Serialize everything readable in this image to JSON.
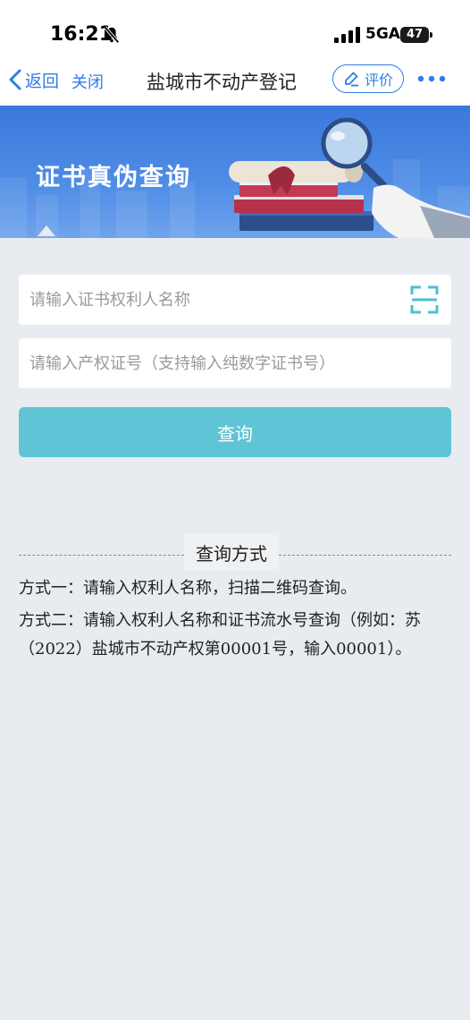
{
  "status_bar": {
    "time": "16:21",
    "network": "5GA",
    "battery": "47"
  },
  "nav": {
    "back_label": "返回",
    "close_label": "关闭",
    "title": "盐城市不动产登记",
    "rate_label": "评价"
  },
  "banner": {
    "title": "证书真伪查询"
  },
  "form": {
    "holder_placeholder": "请输入证书权利人名称",
    "cert_placeholder": "请输入产权证号（支持输入纯数字证书号）",
    "submit_label": "查询"
  },
  "methods": {
    "title": "查询方式",
    "method1": "方式一：请输入权利人名称，扫描二维码查询。",
    "method2": "方式二：请输入权利人名称和证书流水号查询（例如：苏（2022）盐城市不动产权第00001号，输入00001）。"
  },
  "colors": {
    "accent": "#2f7ce8",
    "button": "#5fc4d6",
    "banner": "#3b78dc",
    "background": "#e8ebf0"
  }
}
